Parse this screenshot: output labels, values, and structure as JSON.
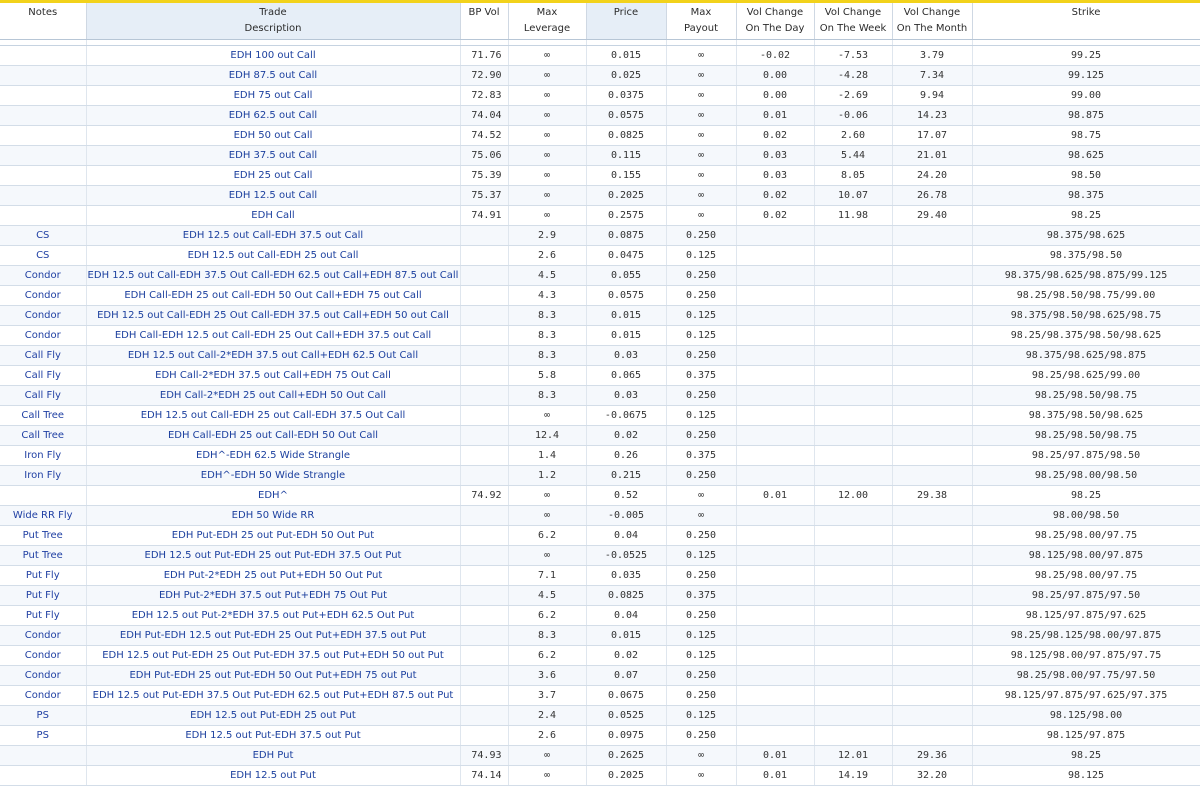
{
  "columns": {
    "notes": "Notes",
    "trade": "Trade",
    "description": "Description",
    "bp_vol": "BP Vol",
    "max_leverage_1": "Max",
    "max_leverage_2": "Leverage",
    "price": "Price",
    "max_payout_1": "Max",
    "max_payout_2": "Payout",
    "vol_day_1": "Vol Change",
    "vol_day_2": "On The Day",
    "vol_week_1": "Vol Change",
    "vol_week_2": "On The Week",
    "vol_month_1": "Vol Change",
    "vol_month_2": "On The Month",
    "strike": "Strike"
  },
  "rows": [
    {
      "notes": "",
      "desc": "EDH 100 out Call",
      "bp": "71.76",
      "lev": "∞",
      "price": "0.015",
      "payout": "∞",
      "day": "-0.02",
      "week": "-7.53",
      "month": "3.79",
      "strike": "99.25"
    },
    {
      "notes": "",
      "desc": "EDH 87.5 out Call",
      "bp": "72.90",
      "lev": "∞",
      "price": "0.025",
      "payout": "∞",
      "day": "0.00",
      "week": "-4.28",
      "month": "7.34",
      "strike": "99.125"
    },
    {
      "notes": "",
      "desc": "EDH 75 out Call",
      "bp": "72.83",
      "lev": "∞",
      "price": "0.0375",
      "payout": "∞",
      "day": "0.00",
      "week": "-2.69",
      "month": "9.94",
      "strike": "99.00"
    },
    {
      "notes": "",
      "desc": "EDH 62.5 out Call",
      "bp": "74.04",
      "lev": "∞",
      "price": "0.0575",
      "payout": "∞",
      "day": "0.01",
      "week": "-0.06",
      "month": "14.23",
      "strike": "98.875"
    },
    {
      "notes": "",
      "desc": "EDH 50 out Call",
      "bp": "74.52",
      "lev": "∞",
      "price": "0.0825",
      "payout": "∞",
      "day": "0.02",
      "week": "2.60",
      "month": "17.07",
      "strike": "98.75"
    },
    {
      "notes": "",
      "desc": "EDH 37.5 out Call",
      "bp": "75.06",
      "lev": "∞",
      "price": "0.115",
      "payout": "∞",
      "day": "0.03",
      "week": "5.44",
      "month": "21.01",
      "strike": "98.625"
    },
    {
      "notes": "",
      "desc": "EDH 25 out Call",
      "bp": "75.39",
      "lev": "∞",
      "price": "0.155",
      "payout": "∞",
      "day": "0.03",
      "week": "8.05",
      "month": "24.20",
      "strike": "98.50"
    },
    {
      "notes": "",
      "desc": "EDH 12.5 out Call",
      "bp": "75.37",
      "lev": "∞",
      "price": "0.2025",
      "payout": "∞",
      "day": "0.02",
      "week": "10.07",
      "month": "26.78",
      "strike": "98.375"
    },
    {
      "notes": "",
      "desc": "EDH Call",
      "bp": "74.91",
      "lev": "∞",
      "price": "0.2575",
      "payout": "∞",
      "day": "0.02",
      "week": "11.98",
      "month": "29.40",
      "strike": "98.25"
    },
    {
      "notes": "CS",
      "desc": "EDH 12.5 out Call-EDH 37.5 out Call",
      "bp": "",
      "lev": "2.9",
      "price": "0.0875",
      "payout": "0.250",
      "day": "",
      "week": "",
      "month": "",
      "strike": "98.375/98.625"
    },
    {
      "notes": "CS",
      "desc": "EDH 12.5 out Call-EDH 25 out Call",
      "bp": "",
      "lev": "2.6",
      "price": "0.0475",
      "payout": "0.125",
      "day": "",
      "week": "",
      "month": "",
      "strike": "98.375/98.50"
    },
    {
      "notes": "Condor",
      "desc": "EDH 12.5 out Call-EDH 37.5 Out Call-EDH 62.5 out Call+EDH 87.5 out Call",
      "bp": "",
      "lev": "4.5",
      "price": "0.055",
      "payout": "0.250",
      "day": "",
      "week": "",
      "month": "",
      "strike": "98.375/98.625/98.875/99.125"
    },
    {
      "notes": "Condor",
      "desc": "EDH Call-EDH 25 out Call-EDH 50 Out Call+EDH 75 out Call",
      "bp": "",
      "lev": "4.3",
      "price": "0.0575",
      "payout": "0.250",
      "day": "",
      "week": "",
      "month": "",
      "strike": "98.25/98.50/98.75/99.00"
    },
    {
      "notes": "Condor",
      "desc": "EDH 12.5 out Call-EDH 25 Out Call-EDH 37.5 out Call+EDH 50 out Call",
      "bp": "",
      "lev": "8.3",
      "price": "0.015",
      "payout": "0.125",
      "day": "",
      "week": "",
      "month": "",
      "strike": "98.375/98.50/98.625/98.75"
    },
    {
      "notes": "Condor",
      "desc": "EDH Call-EDH 12.5 out Call-EDH 25 Out Call+EDH 37.5 out Call",
      "bp": "",
      "lev": "8.3",
      "price": "0.015",
      "payout": "0.125",
      "day": "",
      "week": "",
      "month": "",
      "strike": "98.25/98.375/98.50/98.625"
    },
    {
      "notes": "Call Fly",
      "desc": "EDH 12.5 out Call-2*EDH 37.5 out Call+EDH 62.5 Out Call",
      "bp": "",
      "lev": "8.3",
      "price": "0.03",
      "payout": "0.250",
      "day": "",
      "week": "",
      "month": "",
      "strike": "98.375/98.625/98.875"
    },
    {
      "notes": "Call Fly",
      "desc": "EDH Call-2*EDH 37.5 out Call+EDH 75 Out Call",
      "bp": "",
      "lev": "5.8",
      "price": "0.065",
      "payout": "0.375",
      "day": "",
      "week": "",
      "month": "",
      "strike": "98.25/98.625/99.00"
    },
    {
      "notes": "Call Fly",
      "desc": "EDH Call-2*EDH 25 out Call+EDH 50 Out Call",
      "bp": "",
      "lev": "8.3",
      "price": "0.03",
      "payout": "0.250",
      "day": "",
      "week": "",
      "month": "",
      "strike": "98.25/98.50/98.75"
    },
    {
      "notes": "Call Tree",
      "desc": "EDH 12.5 out Call-EDH 25 out Call-EDH 37.5 Out Call",
      "bp": "",
      "lev": "∞",
      "price": "-0.0675",
      "payout": "0.125",
      "day": "",
      "week": "",
      "month": "",
      "strike": "98.375/98.50/98.625"
    },
    {
      "notes": "Call Tree",
      "desc": "EDH Call-EDH 25 out Call-EDH 50 Out Call",
      "bp": "",
      "lev": "12.4",
      "price": "0.02",
      "payout": "0.250",
      "day": "",
      "week": "",
      "month": "",
      "strike": "98.25/98.50/98.75"
    },
    {
      "notes": "Iron Fly",
      "desc": "EDH^-EDH 62.5 Wide Strangle",
      "bp": "",
      "lev": "1.4",
      "price": "0.26",
      "payout": "0.375",
      "day": "",
      "week": "",
      "month": "",
      "strike": "98.25/97.875/98.50"
    },
    {
      "notes": "Iron Fly",
      "desc": "EDH^-EDH 50 Wide Strangle",
      "bp": "",
      "lev": "1.2",
      "price": "0.215",
      "payout": "0.250",
      "day": "",
      "week": "",
      "month": "",
      "strike": "98.25/98.00/98.50"
    },
    {
      "notes": "",
      "desc": "EDH^",
      "bp": "74.92",
      "lev": "∞",
      "price": "0.52",
      "payout": "∞",
      "day": "0.01",
      "week": "12.00",
      "month": "29.38",
      "strike": "98.25"
    },
    {
      "notes": "Wide RR Fly",
      "desc": "EDH 50 Wide RR",
      "bp": "",
      "lev": "∞",
      "price": "-0.005",
      "payout": "∞",
      "day": "",
      "week": "",
      "month": "",
      "strike": "98.00/98.50"
    },
    {
      "notes": "Put Tree",
      "desc": "EDH Put-EDH 25 out Put-EDH 50 Out Put",
      "bp": "",
      "lev": "6.2",
      "price": "0.04",
      "payout": "0.250",
      "day": "",
      "week": "",
      "month": "",
      "strike": "98.25/98.00/97.75"
    },
    {
      "notes": "Put Tree",
      "desc": "EDH 12.5 out Put-EDH 25 out Put-EDH 37.5 Out Put",
      "bp": "",
      "lev": "∞",
      "price": "-0.0525",
      "payout": "0.125",
      "day": "",
      "week": "",
      "month": "",
      "strike": "98.125/98.00/97.875"
    },
    {
      "notes": "Put Fly",
      "desc": "EDH Put-2*EDH 25 out Put+EDH 50 Out Put",
      "bp": "",
      "lev": "7.1",
      "price": "0.035",
      "payout": "0.250",
      "day": "",
      "week": "",
      "month": "",
      "strike": "98.25/98.00/97.75"
    },
    {
      "notes": "Put Fly",
      "desc": "EDH Put-2*EDH 37.5 out Put+EDH 75 Out Put",
      "bp": "",
      "lev": "4.5",
      "price": "0.0825",
      "payout": "0.375",
      "day": "",
      "week": "",
      "month": "",
      "strike": "98.25/97.875/97.50"
    },
    {
      "notes": "Put Fly",
      "desc": "EDH 12.5 out Put-2*EDH 37.5 out Put+EDH 62.5 Out Put",
      "bp": "",
      "lev": "6.2",
      "price": "0.04",
      "payout": "0.250",
      "day": "",
      "week": "",
      "month": "",
      "strike": "98.125/97.875/97.625"
    },
    {
      "notes": "Condor",
      "desc": "EDH Put-EDH 12.5 out Put-EDH 25 Out Put+EDH 37.5 out Put",
      "bp": "",
      "lev": "8.3",
      "price": "0.015",
      "payout": "0.125",
      "day": "",
      "week": "",
      "month": "",
      "strike": "98.25/98.125/98.00/97.875"
    },
    {
      "notes": "Condor",
      "desc": "EDH 12.5 out Put-EDH 25 Out Put-EDH 37.5 out Put+EDH 50 out Put",
      "bp": "",
      "lev": "6.2",
      "price": "0.02",
      "payout": "0.125",
      "day": "",
      "week": "",
      "month": "",
      "strike": "98.125/98.00/97.875/97.75"
    },
    {
      "notes": "Condor",
      "desc": "EDH Put-EDH 25 out Put-EDH 50 Out Put+EDH 75 out Put",
      "bp": "",
      "lev": "3.6",
      "price": "0.07",
      "payout": "0.250",
      "day": "",
      "week": "",
      "month": "",
      "strike": "98.25/98.00/97.75/97.50"
    },
    {
      "notes": "Condor",
      "desc": "EDH 12.5 out Put-EDH 37.5 Out Put-EDH 62.5 out Put+EDH 87.5 out Put",
      "bp": "",
      "lev": "3.7",
      "price": "0.0675",
      "payout": "0.250",
      "day": "",
      "week": "",
      "month": "",
      "strike": "98.125/97.875/97.625/97.375"
    },
    {
      "notes": "PS",
      "desc": "EDH 12.5 out Put-EDH 25 out Put",
      "bp": "",
      "lev": "2.4",
      "price": "0.0525",
      "payout": "0.125",
      "day": "",
      "week": "",
      "month": "",
      "strike": "98.125/98.00"
    },
    {
      "notes": "PS",
      "desc": "EDH 12.5 out Put-EDH 37.5 out Put",
      "bp": "",
      "lev": "2.6",
      "price": "0.0975",
      "payout": "0.250",
      "day": "",
      "week": "",
      "month": "",
      "strike": "98.125/97.875"
    },
    {
      "notes": "",
      "desc": "EDH Put",
      "bp": "74.93",
      "lev": "∞",
      "price": "0.2625",
      "payout": "∞",
      "day": "0.01",
      "week": "12.01",
      "month": "29.36",
      "strike": "98.25"
    },
    {
      "notes": "",
      "desc": "EDH 12.5 out Put",
      "bp": "74.14",
      "lev": "∞",
      "price": "0.2025",
      "payout": "∞",
      "day": "0.01",
      "week": "14.19",
      "month": "32.20",
      "strike": "98.125"
    }
  ]
}
